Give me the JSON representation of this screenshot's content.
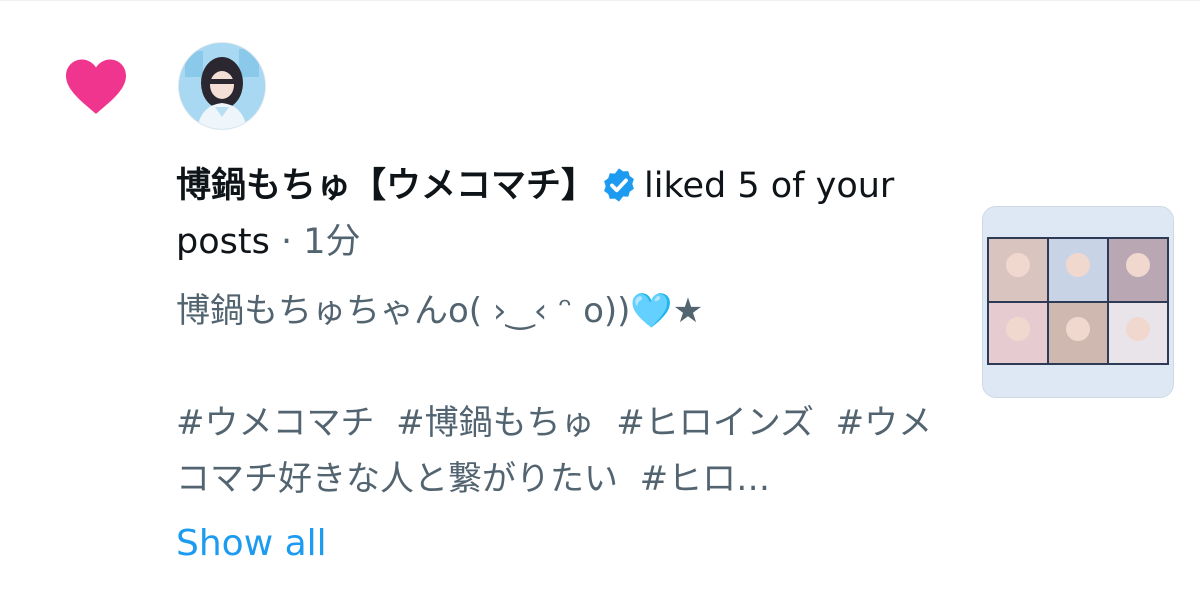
{
  "notification": {
    "actor_name": "博鍋もちゅ【ウメコマチ】",
    "action_text": "liked 5 of your posts",
    "separator": "·",
    "time": "1分",
    "post_text": "博鍋もちゅちゃんo( ›‿‹ ᵔ o))🩵★\n\n#ウメコマチ  #博鍋もちゅ  #ヒロインズ  #ウメコマチ好きな人と繋がりたい  #ヒロ…",
    "show_all_label": "Show all",
    "icons": {
      "type_icon": "heart-icon",
      "badge": "verified-badge-icon"
    },
    "colors": {
      "heart": "#f0358f",
      "verified": "#1d9bf0",
      "link": "#1d9bf0",
      "secondary_text": "#536471",
      "primary_text": "#0f1419"
    }
  }
}
